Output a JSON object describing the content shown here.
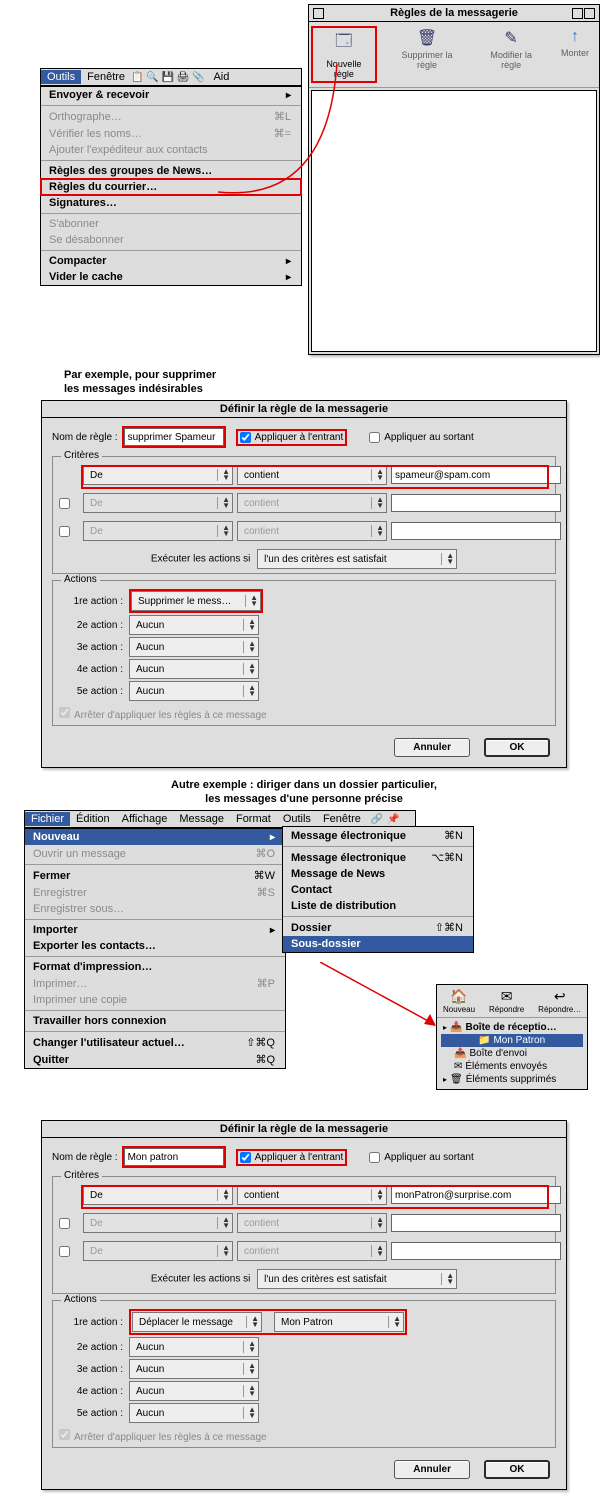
{
  "rulesWindow": {
    "title": "Règles de la messagerie",
    "toolbar": [
      {
        "name": "new",
        "label": "Nouvelle règle"
      },
      {
        "name": "delete",
        "label": "Supprimer la règle"
      },
      {
        "name": "edit",
        "label": "Modifier la règle"
      },
      {
        "name": "up",
        "label": "Monter"
      }
    ]
  },
  "outilsMenu": {
    "barItems": [
      "Outils",
      "Fenêtre",
      "Aid"
    ],
    "items": [
      {
        "label": "Envoyer & recevoir",
        "sub": true
      },
      {
        "sep": true
      },
      {
        "label": "Orthographe…",
        "sc": "⌘L",
        "grey": true
      },
      {
        "label": "Vérifier les noms…",
        "sc": "⌘=",
        "grey": true
      },
      {
        "label": "Ajouter l'expéditeur aux contacts",
        "grey": true
      },
      {
        "sep": true
      },
      {
        "label": "Règles des groupes de News…"
      },
      {
        "label": "Règles du courrier…",
        "box": true
      },
      {
        "label": "Signatures…"
      },
      {
        "sep": true
      },
      {
        "label": "S'abonner",
        "grey": true
      },
      {
        "label": "Se désabonner",
        "grey": true
      },
      {
        "sep": true
      },
      {
        "label": "Compacter",
        "sub": true
      },
      {
        "label": "Vider le cache",
        "sub": true
      }
    ]
  },
  "caption1": {
    "l1": "Par exemple, pour supprimer",
    "l2": "les messages indésirables"
  },
  "dialog1": {
    "title": "Définir la règle de la messagerie",
    "nameLabel": "Nom de règle :",
    "nameVal": "supprimer Spameur",
    "applyIn": "Appliquer à l'entrant",
    "applyOut": "Appliquer au sortant",
    "critLegend": "Critères",
    "crit1": {
      "field": "De",
      "op": "contient",
      "val": "spameur@spam.com"
    },
    "critGrey": {
      "field": "De",
      "op": "contient"
    },
    "execLabel": "Exécuter les actions si",
    "execVal": "l'un des critères est satisfait",
    "actLegend": "Actions",
    "a1": {
      "lbl": "1re action :",
      "val": "Supprimer le mess…"
    },
    "a2": {
      "lbl": "2e action :",
      "val": "Aucun"
    },
    "a3": {
      "lbl": "3e action :",
      "val": "Aucun"
    },
    "a4": {
      "lbl": "4e action :",
      "val": "Aucun"
    },
    "a5": {
      "lbl": "5e action :",
      "val": "Aucun"
    },
    "stop": "Arrêter d'appliquer les règles à ce message",
    "cancel": "Annuler",
    "ok": "OK"
  },
  "caption2": {
    "l1": "Autre exemple : diriger dans un dossier particulier,",
    "l2": "les messages d'une personne précise"
  },
  "fichierMenu": {
    "bar": [
      "Fichier",
      "Édition",
      "Affichage",
      "Message",
      "Format",
      "Outils",
      "Fenêtre"
    ],
    "items": [
      {
        "label": "Nouveau",
        "sub": true,
        "sel": true
      },
      {
        "label": "Ouvrir un message",
        "sc": "⌘O",
        "grey": true
      },
      {
        "sep": true
      },
      {
        "label": "Fermer",
        "sc": "⌘W"
      },
      {
        "label": "Enregistrer",
        "sc": "⌘S",
        "grey": true
      },
      {
        "label": "Enregistrer sous…",
        "grey": true
      },
      {
        "sep": true
      },
      {
        "label": "Importer",
        "sub": true
      },
      {
        "label": "Exporter les contacts…"
      },
      {
        "sep": true
      },
      {
        "label": "Format d'impression…"
      },
      {
        "label": "Imprimer…",
        "sc": "⌘P",
        "grey": true
      },
      {
        "label": "Imprimer une copie",
        "grey": true
      },
      {
        "sep": true
      },
      {
        "label": "Travailler hors connexion"
      },
      {
        "sep": true
      },
      {
        "label": "Changer l'utilisateur actuel…",
        "sc": "⇧⌘Q"
      },
      {
        "label": "Quitter",
        "sc": "⌘Q"
      }
    ],
    "submenu": [
      {
        "label": "Message électronique",
        "sc": "⌘N"
      },
      {
        "sep": true
      },
      {
        "label": "Message électronique",
        "sc": "⌥⌘N"
      },
      {
        "label": "Message de News"
      },
      {
        "label": "Contact"
      },
      {
        "label": "Liste de distribution"
      },
      {
        "sep": true
      },
      {
        "label": "Dossier",
        "sc": "⇧⌘N"
      },
      {
        "label": "Sous-dossier",
        "sel": true
      }
    ]
  },
  "sidebar": {
    "tools": [
      {
        "label": "Nouveau"
      },
      {
        "label": "Répondre"
      },
      {
        "label": "Répondre…"
      }
    ],
    "tree": [
      {
        "label": "Boîte de réceptio…",
        "icon": "📥",
        "bold": true,
        "arrow": true
      },
      {
        "label": "Mon Patron",
        "icon": "📁",
        "sel": true,
        "indent": true
      },
      {
        "label": "Boîte d'envoi",
        "icon": "📤"
      },
      {
        "label": "Éléments envoyés",
        "icon": "✉"
      },
      {
        "label": "Éléments supprimés",
        "icon": "🗑",
        "arrow": true
      }
    ]
  },
  "dialog2": {
    "title": "Définir la règle de la messagerie",
    "nameLabel": "Nom de règle :",
    "nameVal": "Mon patron",
    "applyIn": "Appliquer à l'entrant",
    "applyOut": "Appliquer au sortant",
    "critLegend": "Critères",
    "crit1": {
      "field": "De",
      "op": "contient",
      "val": "monPatron@surprise.com"
    },
    "critGrey": {
      "field": "De",
      "op": "contient"
    },
    "execLabel": "Exécuter les actions si",
    "execVal": "l'un des critères est satisfait",
    "actLegend": "Actions",
    "a1": {
      "lbl": "1re action :",
      "val": "Déplacer le message",
      "target": "Mon Patron"
    },
    "a2": {
      "lbl": "2e action :",
      "val": "Aucun"
    },
    "a3": {
      "lbl": "3e action :",
      "val": "Aucun"
    },
    "a4": {
      "lbl": "4e action :",
      "val": "Aucun"
    },
    "a5": {
      "lbl": "5e action :",
      "val": "Aucun"
    },
    "stop": "Arrêter d'appliquer les règles à ce message",
    "cancel": "Annuler",
    "ok": "OK"
  }
}
